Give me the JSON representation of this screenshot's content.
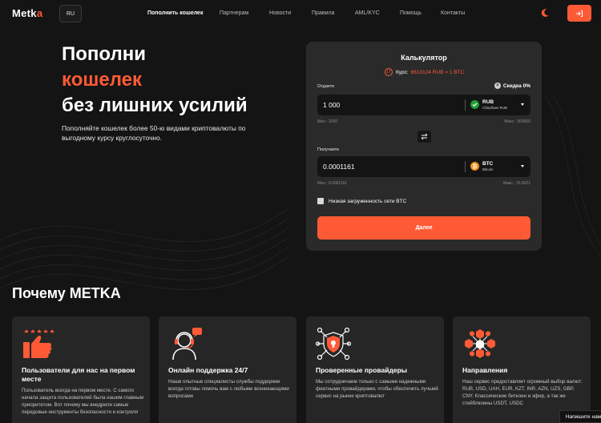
{
  "header": {
    "logo_main": "Metk",
    "logo_accent": "a",
    "lang": "RU",
    "nav": [
      {
        "label": "Пополнить кошелек",
        "active": true
      },
      {
        "label": "Партнерам"
      },
      {
        "label": "Новости"
      },
      {
        "label": "Правила"
      },
      {
        "label": "AML/KYC"
      },
      {
        "label": "Помощь"
      },
      {
        "label": "Контакты"
      }
    ],
    "theme_icon": "moon-icon",
    "login_icon": "login-icon"
  },
  "hero": {
    "line1": "Пополни",
    "line2": "кошелек",
    "line3": "без лишних усилий",
    "subtitle": "Пополняйте кошелек более 50-ю видами криптовалюты по выгодному курсу круглосуточно."
  },
  "calculator": {
    "title": "Калькулятор",
    "rate_badge": "17",
    "rate_label": "Курс:",
    "rate_value": "6613124 RUB = 1 BTC",
    "send_label": "Отдаете",
    "discount": "Скидка 0%",
    "send_amount": "1 000",
    "send_currency": "RUB",
    "send_currency_name": "Сбербанк RUB",
    "send_min": "Мин.: 1000",
    "send_max": "Макс.: 300000",
    "receive_label": "Получаете",
    "receive_amount": "0.0001161",
    "receive_currency": "BTC",
    "receive_currency_name": "Bitcoin",
    "receive_min": "Мин.: 0.0001161",
    "receive_max": "Макс.: 15.8921",
    "network_note": "Низкая загруженность сети BTC",
    "next_button": "Далее"
  },
  "why": {
    "title": "Почему METKA",
    "cards": [
      {
        "icon": "thumbs-up-stars-icon",
        "title": "Пользователи для нас на первом месте",
        "text": "Пользователь всегда на первом месте. С самого начала защита пользователей была нашим главным приоритетом. Вот почему мы внедрили самые передовые инструменты безопасности и контроля"
      },
      {
        "icon": "support-agent-icon",
        "title": "Онлайн поддержка 24/7",
        "text": "Наши опытные специалисты службы поддержки всегда готовы помочь вам с любыми возникающими вопросами"
      },
      {
        "icon": "shield-network-icon",
        "title": "Проверенные провайдеры",
        "text": "Мы сотрудничаем только с самыми надежными фиатными провайдерами, чтобы обеспечить лучший сервис на рынке криптовалют"
      },
      {
        "icon": "cubes-network-icon",
        "title": "Направления",
        "text": "Наш сервис предоставляет огромный выбор валют: RUB, USD, UAH, EUR, KZT, INR, AZN, UZS, GBP, CNY. Классические биткоин и эфир, а так же стейблкоины USDT, USDC"
      }
    ]
  },
  "chat_widget": "Напишите нам",
  "colors": {
    "accent": "#ff5a36",
    "background": "#141414",
    "panel": "#2a2a2a",
    "card": "#262626"
  }
}
